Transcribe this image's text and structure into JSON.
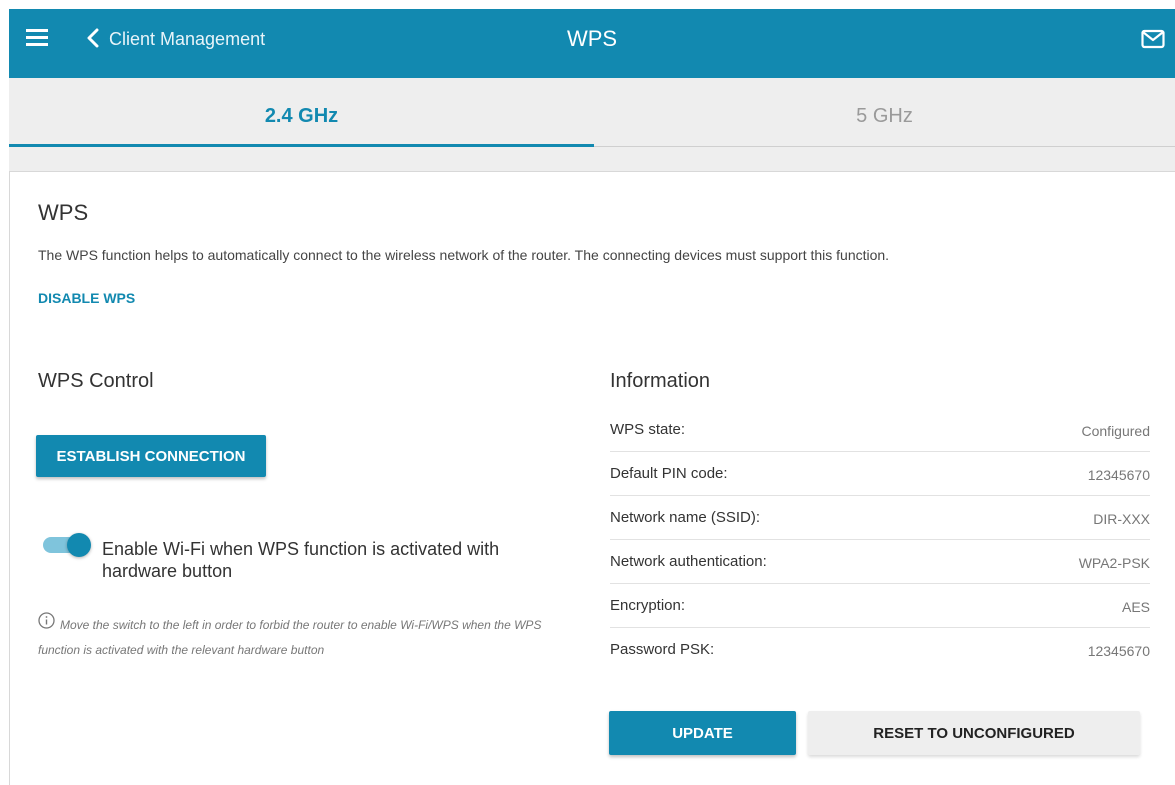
{
  "header": {
    "back_label": "Client Management",
    "title": "WPS",
    "menu_icon": "hamburger-menu-icon",
    "back_icon": "chevron-left-icon",
    "mail_icon": "mail-icon",
    "color": "#1289b0"
  },
  "tabs": [
    {
      "label": "2.4 GHz",
      "active": true
    },
    {
      "label": "5 GHz",
      "active": false
    }
  ],
  "wps": {
    "title": "WPS",
    "description": "The WPS function helps to automatically connect to the wireless network of the router. The connecting devices must support this function.",
    "disable_label": "DISABLE WPS"
  },
  "control": {
    "title": "WPS Control",
    "establish_label": "ESTABLISH CONNECTION",
    "toggle_on": true,
    "toggle_label": "Enable Wi-Fi when WPS function is activated with hardware button",
    "hint_icon": "info-circle-icon",
    "hint": "Move the switch to the left in order to forbid the router to enable Wi-Fi/WPS when the WPS function is activated with the relevant hardware button"
  },
  "information": {
    "title": "Information",
    "rows": [
      {
        "label": "WPS state:",
        "value": "Configured"
      },
      {
        "label": "Default PIN code:",
        "value": "12345670"
      },
      {
        "label": "Network name (SSID):",
        "value": "DIR-XXX"
      },
      {
        "label": "Network authentication:",
        "value": "WPA2-PSK"
      },
      {
        "label": "Encryption:",
        "value": "AES"
      },
      {
        "label": "Password PSK:",
        "value": "12345670"
      }
    ],
    "update_label": "UPDATE",
    "reset_label": "RESET TO UNCONFIGURED"
  }
}
